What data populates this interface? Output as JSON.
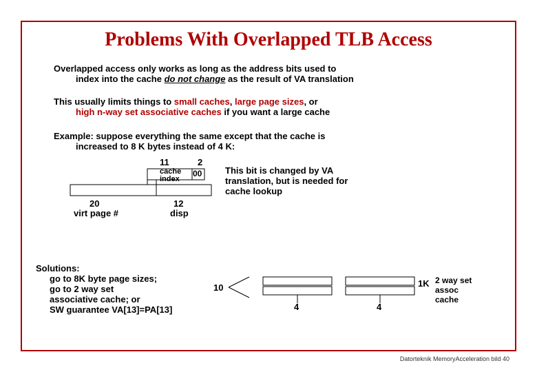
{
  "title": "Problems With Overlapped TLB Access",
  "para1_a": "Overlapped access only works as long as the address bits used to",
  "para1_b": "index into the cache ",
  "para1_c": "do not change",
  "para1_d": "  as the result of VA translation",
  "para2_a": "This usually limits things to ",
  "para2_small": "small caches",
  "para2_b": ", ",
  "para2_large": "large page sizes",
  "para2_c": ", or",
  "para2_d": "high n-way set associative caches",
  "para2_e": " if you want a large cache",
  "para3_a": "Example:  suppose everything the same except that the cache is",
  "para3_b": "increased to 8 K bytes instead of 4 K:",
  "d1": {
    "n11": "11",
    "n2": "2",
    "cache": "cache",
    "index": "index",
    "n00": "00",
    "n20": "20",
    "virt": "virt page #",
    "n12": "12",
    "disp": "disp"
  },
  "right_note": "This bit is changed by VA translation, but is needed for cache lookup",
  "solutions_h": "Solutions:",
  "sol1": "go to 8K byte page sizes;",
  "sol2": "go to 2 way set",
  "sol3": "associative cache; or",
  "sol4": "SW guarantee VA[13]=PA[13]",
  "d2": {
    "n10": "10",
    "n4a": "4",
    "n4b": "4",
    "n1k": "1K",
    "right": "2 way set assoc cache"
  },
  "footer": "Datorteknik MemoryAcceleration bild 40"
}
